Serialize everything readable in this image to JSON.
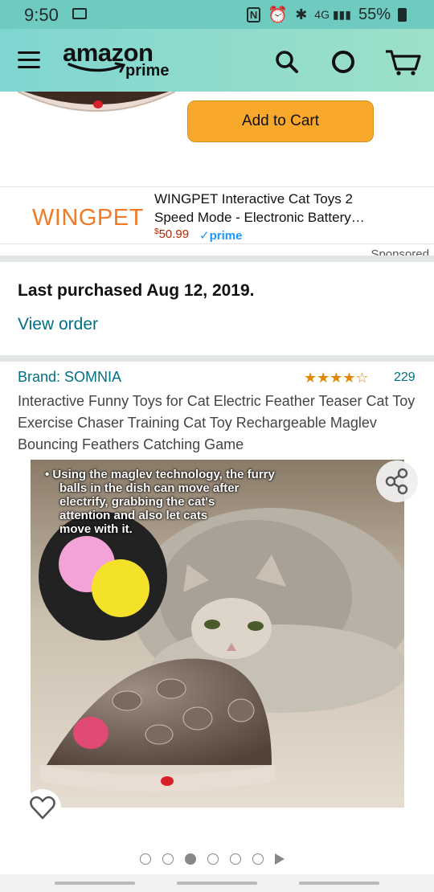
{
  "status": {
    "time": "9:50",
    "battery": "55%"
  },
  "header": {
    "logo_word": "amazon",
    "logo_prime": "prime"
  },
  "cart_section": {
    "add_to_cart_label": "Add to Cart"
  },
  "ad": {
    "brand_logo": "WINGPET",
    "title": "WINGPET Interactive Cat Toys 2 Speed Mode - Electronic Battery…",
    "price_symbol": "$",
    "price": "50.99",
    "prime_label": "✓prime",
    "sponsored_label": "Sponsored"
  },
  "purchase": {
    "title": "Last purchased Aug 12, 2019.",
    "view_order_label": "View order"
  },
  "product": {
    "brand": "Brand: SOMNIA",
    "stars": "★★★★☆",
    "rating": 3.5,
    "rating_count": "229",
    "title": "Interactive Funny Toys for Cat Electric Feather Teaser Cat Toy Exercise Chaser Training Cat Toy Rechargeable Maglev Bouncing Feathers Catching Game",
    "image_caption_lines": [
      "• Using the maglev technology, the furry",
      "balls in the dish can move after",
      "electrify, grabbing the cat's",
      "attention and also let cats",
      "move with it."
    ]
  },
  "carousel": {
    "dot_count": 6,
    "active_index": 2
  },
  "colors": {
    "accent": "#f8a82a",
    "link": "#007185",
    "header": "#7fd6d1",
    "brand_logo": "#f07a26"
  }
}
